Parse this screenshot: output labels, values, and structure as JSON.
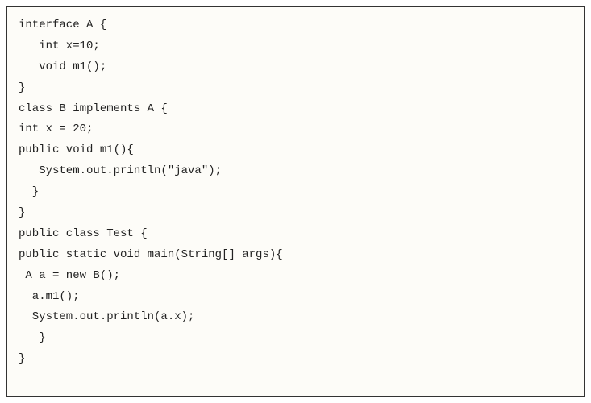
{
  "code": {
    "lines": [
      "interface A {",
      "   int x=10;",
      "   void m1();",
      "}",
      "class B implements A {",
      "int x = 20;",
      "public void m1(){",
      "   System.out.println(\"java\");",
      "  }",
      "}",
      "public class Test {",
      "public static void main(String[] args){",
      " A a = new B();",
      "  a.m1();",
      "  System.out.println(a.x);",
      "   }",
      "}"
    ]
  }
}
